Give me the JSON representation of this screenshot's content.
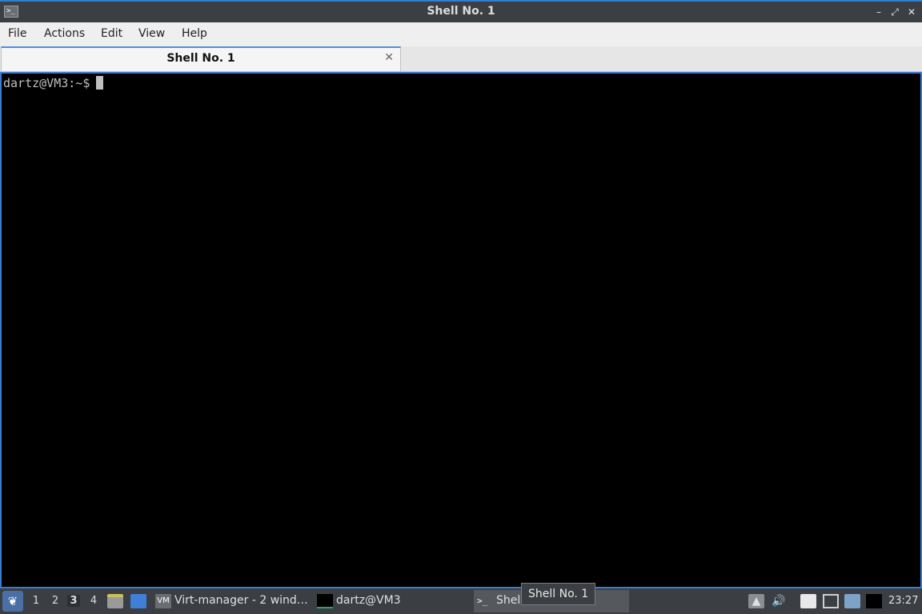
{
  "window": {
    "title": "Shell No. 1",
    "app_icon_glyph": ">_",
    "controls": {
      "minimize": "–",
      "maximize": "⤢",
      "close": "✕"
    }
  },
  "menu": {
    "items": [
      "File",
      "Actions",
      "Edit",
      "View",
      "Help"
    ]
  },
  "tabs": [
    {
      "label": "Shell No. 1",
      "close": "✕"
    }
  ],
  "terminal": {
    "prompt": "dartz@VM3:~$",
    "background": "#000000",
    "foreground": "#bfbfbf"
  },
  "taskbar": {
    "workspaces": [
      "1",
      "2",
      "3",
      "4"
    ],
    "active_workspace": "3",
    "tasks": [
      {
        "label": "Virt-manager - 2 wind…",
        "icon": "vm-icon"
      },
      {
        "label": "dartz@VM3",
        "icon": "terminal-black-icon"
      },
      {
        "label": "Shell",
        "icon": "terminal-icon"
      }
    ],
    "tooltip": "Shell No. 1",
    "clock": "23:27",
    "colors": {
      "accent": "#3a7bd5",
      "panel": "#3b3e42"
    }
  }
}
